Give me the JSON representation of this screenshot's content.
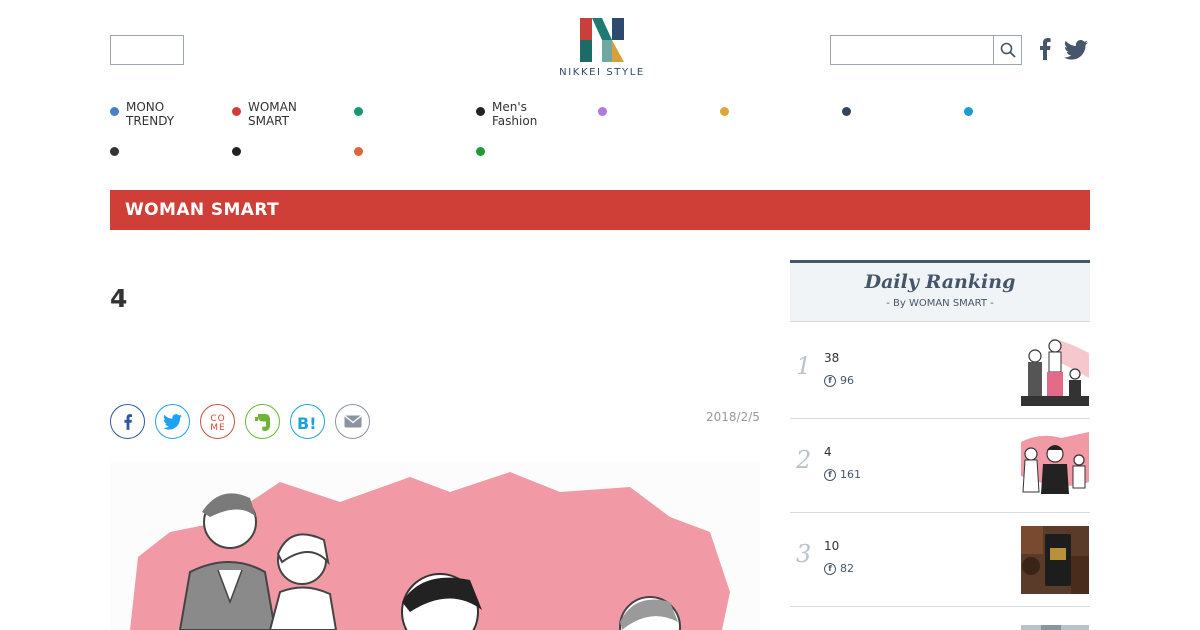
{
  "header": {
    "logo_text": "NIKKEI STYLE",
    "search_placeholder": "",
    "social": [
      "facebook-icon",
      "twitter-icon"
    ]
  },
  "nav": {
    "row1": [
      {
        "label": "MONO\nTRENDY",
        "color": "#4a7fc8"
      },
      {
        "label": "WOMAN\nSMART",
        "color": "#d03e38"
      },
      {
        "label": "",
        "color": "#18967a"
      },
      {
        "label": "Men's\nFashion",
        "color": "#222222"
      },
      {
        "label": "",
        "color": "#b27ad8"
      },
      {
        "label": "",
        "color": "#dba63a"
      },
      {
        "label": "",
        "color": "#33455e"
      },
      {
        "label": "",
        "color": "#1c9ad8"
      }
    ],
    "row2": [
      {
        "label": "",
        "color": "#333333"
      },
      {
        "label": "",
        "color": "#222222"
      },
      {
        "label": "",
        "color": "#e0623a"
      },
      {
        "label": "",
        "color": "#1f9a3a"
      }
    ]
  },
  "category": {
    "title": "WOMAN SMART",
    "color": "#d03e38"
  },
  "article": {
    "title": "4",
    "date": "2018/2/5",
    "share": [
      {
        "name": "facebook",
        "color": "#34579c"
      },
      {
        "name": "twitter",
        "color": "#1da1f2"
      },
      {
        "name": "come",
        "color": "#d34b3c"
      },
      {
        "name": "evernote",
        "color": "#6fb536"
      },
      {
        "name": "hatena",
        "color": "#1ba3e0"
      },
      {
        "name": "mail",
        "color": "#8a94a0"
      }
    ]
  },
  "ranking": {
    "title": "Daily Ranking",
    "subtitle": "- By WOMAN SMART -",
    "items": [
      {
        "rank": "1",
        "title": "38",
        "count": "96"
      },
      {
        "rank": "2",
        "title": "4",
        "count": "161"
      },
      {
        "rank": "3",
        "title": "10",
        "count": "82"
      }
    ]
  }
}
